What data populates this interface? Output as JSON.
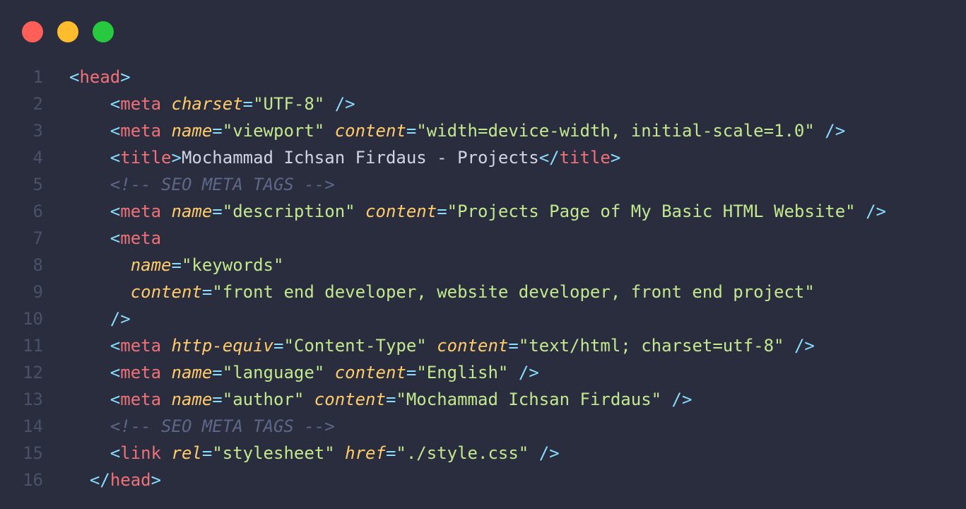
{
  "window_controls": [
    {
      "name": "close",
      "color": "#ff5f56"
    },
    {
      "name": "minimize",
      "color": "#ffbd2e"
    },
    {
      "name": "maximize",
      "color": "#27c93f"
    }
  ],
  "colors": {
    "background": "#292d3e",
    "line_number": "#4b5166",
    "punctuation": "#89ddff",
    "tag": "#f07178",
    "attribute": "#ffcb6b",
    "string": "#c3e88d",
    "text": "#d0d4e4",
    "comment": "#5f6788"
  },
  "lines": [
    {
      "n": "1",
      "indent": "",
      "tokens": [
        [
          "punc",
          "<"
        ],
        [
          "tag",
          "head"
        ],
        [
          "punc",
          ">"
        ]
      ]
    },
    {
      "n": "2",
      "indent": "    ",
      "tokens": [
        [
          "punc",
          "<"
        ],
        [
          "tag",
          "meta"
        ],
        [
          "text",
          " "
        ],
        [
          "attr",
          "charset"
        ],
        [
          "punc",
          "="
        ],
        [
          "str",
          "\"UTF-8\""
        ],
        [
          "text",
          " "
        ],
        [
          "punc",
          "/>"
        ]
      ]
    },
    {
      "n": "3",
      "indent": "    ",
      "tokens": [
        [
          "punc",
          "<"
        ],
        [
          "tag",
          "meta"
        ],
        [
          "text",
          " "
        ],
        [
          "attr",
          "name"
        ],
        [
          "punc",
          "="
        ],
        [
          "str",
          "\"viewport\""
        ],
        [
          "text",
          " "
        ],
        [
          "attr",
          "content"
        ],
        [
          "punc",
          "="
        ],
        [
          "str",
          "\"width=device-width, initial-scale=1.0\""
        ],
        [
          "text",
          " "
        ],
        [
          "punc",
          "/>"
        ]
      ]
    },
    {
      "n": "4",
      "indent": "    ",
      "tokens": [
        [
          "punc",
          "<"
        ],
        [
          "tag",
          "title"
        ],
        [
          "punc",
          ">"
        ],
        [
          "text",
          "Mochammad Ichsan Firdaus - Projects"
        ],
        [
          "punc",
          "</"
        ],
        [
          "tag",
          "title"
        ],
        [
          "punc",
          ">"
        ]
      ]
    },
    {
      "n": "5",
      "indent": "    ",
      "tokens": [
        [
          "cmt",
          "<!-- SEO META TAGS -->"
        ]
      ]
    },
    {
      "n": "6",
      "indent": "    ",
      "tokens": [
        [
          "punc",
          "<"
        ],
        [
          "tag",
          "meta"
        ],
        [
          "text",
          " "
        ],
        [
          "attr",
          "name"
        ],
        [
          "punc",
          "="
        ],
        [
          "str",
          "\"description\""
        ],
        [
          "text",
          " "
        ],
        [
          "attr",
          "content"
        ],
        [
          "punc",
          "="
        ],
        [
          "str",
          "\"Projects Page of My Basic HTML Website\""
        ],
        [
          "text",
          " "
        ],
        [
          "punc",
          "/>"
        ]
      ]
    },
    {
      "n": "7",
      "indent": "    ",
      "tokens": [
        [
          "punc",
          "<"
        ],
        [
          "tag",
          "meta"
        ]
      ]
    },
    {
      "n": "8",
      "indent": "      ",
      "tokens": [
        [
          "attr",
          "name"
        ],
        [
          "punc",
          "="
        ],
        [
          "str",
          "\"keywords\""
        ]
      ]
    },
    {
      "n": "9",
      "indent": "      ",
      "tokens": [
        [
          "attr",
          "content"
        ],
        [
          "punc",
          "="
        ],
        [
          "str",
          "\"front end developer, website developer, front end project\""
        ]
      ]
    },
    {
      "n": "10",
      "indent": "    ",
      "tokens": [
        [
          "punc",
          "/>"
        ]
      ]
    },
    {
      "n": "11",
      "indent": "    ",
      "tokens": [
        [
          "punc",
          "<"
        ],
        [
          "tag",
          "meta"
        ],
        [
          "text",
          " "
        ],
        [
          "attr",
          "http-equiv"
        ],
        [
          "punc",
          "="
        ],
        [
          "str",
          "\"Content-Type\""
        ],
        [
          "text",
          " "
        ],
        [
          "attr",
          "content"
        ],
        [
          "punc",
          "="
        ],
        [
          "str",
          "\"text/html; charset=utf-8\""
        ],
        [
          "text",
          " "
        ],
        [
          "punc",
          "/>"
        ]
      ]
    },
    {
      "n": "12",
      "indent": "    ",
      "tokens": [
        [
          "punc",
          "<"
        ],
        [
          "tag",
          "meta"
        ],
        [
          "text",
          " "
        ],
        [
          "attr",
          "name"
        ],
        [
          "punc",
          "="
        ],
        [
          "str",
          "\"language\""
        ],
        [
          "text",
          " "
        ],
        [
          "attr",
          "content"
        ],
        [
          "punc",
          "="
        ],
        [
          "str",
          "\"English\""
        ],
        [
          "text",
          " "
        ],
        [
          "punc",
          "/>"
        ]
      ]
    },
    {
      "n": "13",
      "indent": "    ",
      "tokens": [
        [
          "punc",
          "<"
        ],
        [
          "tag",
          "meta"
        ],
        [
          "text",
          " "
        ],
        [
          "attr",
          "name"
        ],
        [
          "punc",
          "="
        ],
        [
          "str",
          "\"author\""
        ],
        [
          "text",
          " "
        ],
        [
          "attr",
          "content"
        ],
        [
          "punc",
          "="
        ],
        [
          "str",
          "\"Mochammad Ichsan Firdaus\""
        ],
        [
          "text",
          " "
        ],
        [
          "punc",
          "/>"
        ]
      ]
    },
    {
      "n": "14",
      "indent": "    ",
      "tokens": [
        [
          "cmt",
          "<!-- SEO META TAGS -->"
        ]
      ]
    },
    {
      "n": "15",
      "indent": "    ",
      "tokens": [
        [
          "punc",
          "<"
        ],
        [
          "tag",
          "link"
        ],
        [
          "text",
          " "
        ],
        [
          "attr",
          "rel"
        ],
        [
          "punc",
          "="
        ],
        [
          "str",
          "\"stylesheet\""
        ],
        [
          "text",
          " "
        ],
        [
          "attr",
          "href"
        ],
        [
          "punc",
          "="
        ],
        [
          "str",
          "\"./style.css\""
        ],
        [
          "text",
          " "
        ],
        [
          "punc",
          "/>"
        ]
      ]
    },
    {
      "n": "16",
      "indent": "  ",
      "tokens": [
        [
          "punc",
          "</"
        ],
        [
          "tag",
          "head"
        ],
        [
          "punc",
          ">"
        ]
      ]
    }
  ]
}
